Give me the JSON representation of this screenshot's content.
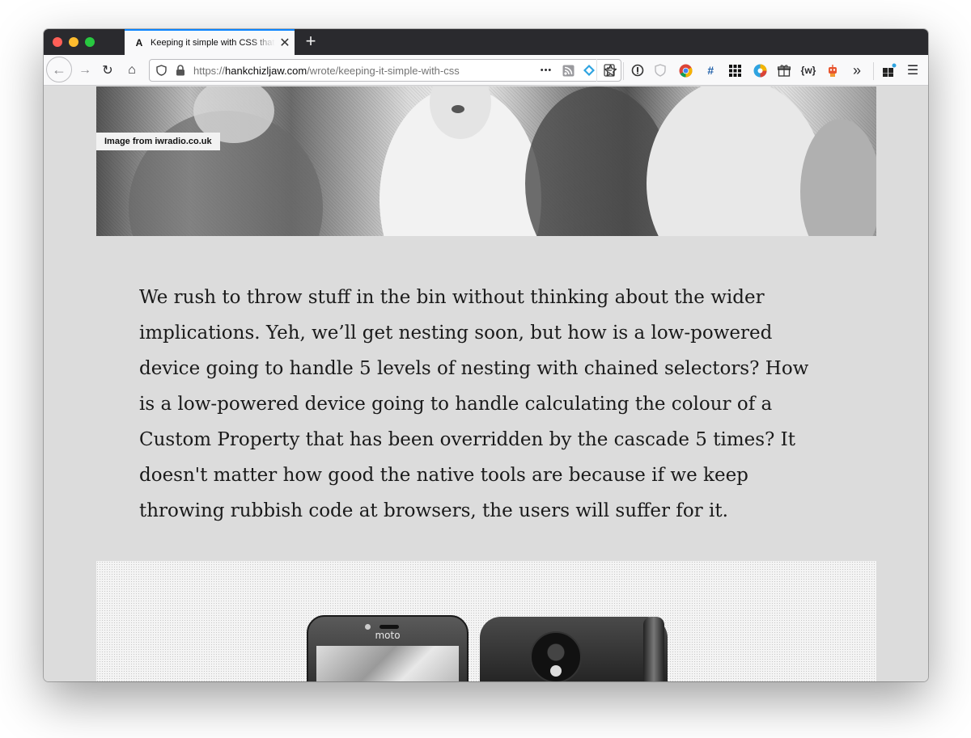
{
  "tab": {
    "title": "Keeping it simple with CSS that",
    "favicon": "A",
    "close": "✕",
    "new_tab": "+"
  },
  "nav": {
    "back": "←",
    "forward": "→",
    "reload": "↻",
    "home": "⌂"
  },
  "url": {
    "scheme": "https://",
    "host": "hankchizljaw.com",
    "path": "/wrote/keeping-it-simple-with-css"
  },
  "toolbar": {
    "more": "•••",
    "overflow": "»",
    "menu": "☰",
    "hash": "#",
    "wiki": "{w}"
  },
  "page": {
    "hero_caption": "Image from iwradio.co.uk",
    "paragraph": "We rush to throw stuff in the bin without thinking about the wider implications. Yeh, we’ll get nesting soon, but how is a low-powered device going to handle 5 levels of nesting with chained selectors? How is a low-powered device going to handle calculating the colour of a Custom Property that has been overridden by the cascade 5 times? It doesn't matter how good the native tools are because if we keep throwing rubbish code at browsers, the users will suffer for it.",
    "phone_logo": "moto"
  },
  "colors": {
    "tab_strip": "#2a2a2e",
    "tab_accent": "#0a84ff",
    "page_background": "#dcdcdc"
  }
}
